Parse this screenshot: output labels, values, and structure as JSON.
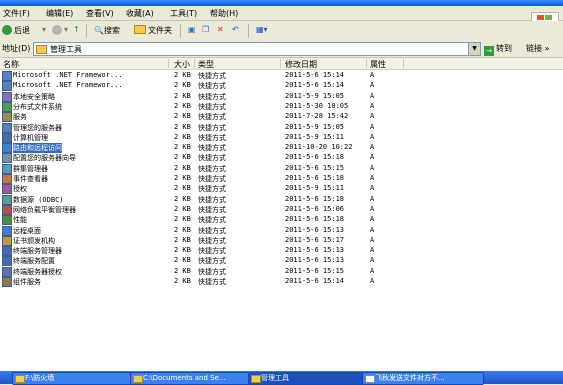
{
  "menu": [
    "文件(F)",
    "编辑(E)",
    "查看(V)",
    "收藏(A)",
    "工具(T)",
    "帮助(H)"
  ],
  "toolbar": {
    "back_label": "后退",
    "search_label": "搜索",
    "folders_label": "文件夹"
  },
  "address": {
    "label": "地址(D)",
    "value": "管理工具",
    "go_label": "转到",
    "links_label": "链接"
  },
  "columns": [
    "名称",
    "大小",
    "类型",
    "修改日期",
    "属性"
  ],
  "rows": [
    {
      "name": "Microsoft .NET Framewor...",
      "size": "2 KB",
      "type": "快捷方式",
      "date": "2011-5-6 15:14",
      "attr": "A"
    },
    {
      "name": "Microsoft .NET Framewor...",
      "size": "2 KB",
      "type": "快捷方式",
      "date": "2011-5-6 15:14",
      "attr": "A"
    },
    {
      "name": "本地安全策略",
      "size": "2 KB",
      "type": "快捷方式",
      "date": "2011-5-9 15:05",
      "attr": "A"
    },
    {
      "name": "分布式文件系统",
      "size": "2 KB",
      "type": "快捷方式",
      "date": "2011-5-30 10:05",
      "attr": "A"
    },
    {
      "name": "服务",
      "size": "2 KB",
      "type": "快捷方式",
      "date": "2011-7-28 15:42",
      "attr": "A"
    },
    {
      "name": "管理您的服务器",
      "size": "2 KB",
      "type": "快捷方式",
      "date": "2011-5-9 15:05",
      "attr": "A"
    },
    {
      "name": "计算机管理",
      "size": "2 KB",
      "type": "快捷方式",
      "date": "2011-5-9 15:11",
      "attr": "A"
    },
    {
      "name": "路由和远程访问",
      "size": "2 KB",
      "type": "快捷方式",
      "date": "2011-10-20 10:22",
      "attr": "A"
    },
    {
      "name": "配置您的服务器向导",
      "size": "2 KB",
      "type": "快捷方式",
      "date": "2011-5-6 15:18",
      "attr": "A"
    },
    {
      "name": "群集管理器",
      "size": "2 KB",
      "type": "快捷方式",
      "date": "2011-5-6 15:15",
      "attr": "A"
    },
    {
      "name": "事件查看器",
      "size": "2 KB",
      "type": "快捷方式",
      "date": "2011-5-6 15:18",
      "attr": "A"
    },
    {
      "name": "授权",
      "size": "2 KB",
      "type": "快捷方式",
      "date": "2011-5-9 15:11",
      "attr": "A"
    },
    {
      "name": "数据源 (ODBC)",
      "size": "2 KB",
      "type": "快捷方式",
      "date": "2011-5-6 15:18",
      "attr": "A"
    },
    {
      "name": "网络负载平衡管理器",
      "size": "2 KB",
      "type": "快捷方式",
      "date": "2011-5-6 15:06",
      "attr": "A"
    },
    {
      "name": "性能",
      "size": "2 KB",
      "type": "快捷方式",
      "date": "2011-5-6 15:18",
      "attr": "A"
    },
    {
      "name": "远程桌面",
      "size": "2 KB",
      "type": "快捷方式",
      "date": "2011-5-6 15:13",
      "attr": "A"
    },
    {
      "name": "证书颁发机构",
      "size": "2 KB",
      "type": "快捷方式",
      "date": "2011-5-6 15:17",
      "attr": "A"
    },
    {
      "name": "终端服务管理器",
      "size": "2 KB",
      "type": "快捷方式",
      "date": "2011-5-6 15:13",
      "attr": "A"
    },
    {
      "name": "终端服务配置",
      "size": "2 KB",
      "type": "快捷方式",
      "date": "2011-5-6 15:13",
      "attr": "A"
    },
    {
      "name": "终端服务器授权",
      "size": "2 KB",
      "type": "快捷方式",
      "date": "2011-5-6 15:15",
      "attr": "A"
    },
    {
      "name": "组件服务",
      "size": "2 KB",
      "type": "快捷方式",
      "date": "2011-5-6 15:14",
      "attr": "A"
    }
  ],
  "selected_row_index": 7,
  "taskbar": [
    "F:\\防火墙",
    "C:\\Documents and Se...",
    "管理工具",
    "飞秋发送文件对方不..."
  ],
  "colors": {
    "selection": "#316ac5",
    "taskbar": "#245edb",
    "menubar": "#ece9d8"
  }
}
